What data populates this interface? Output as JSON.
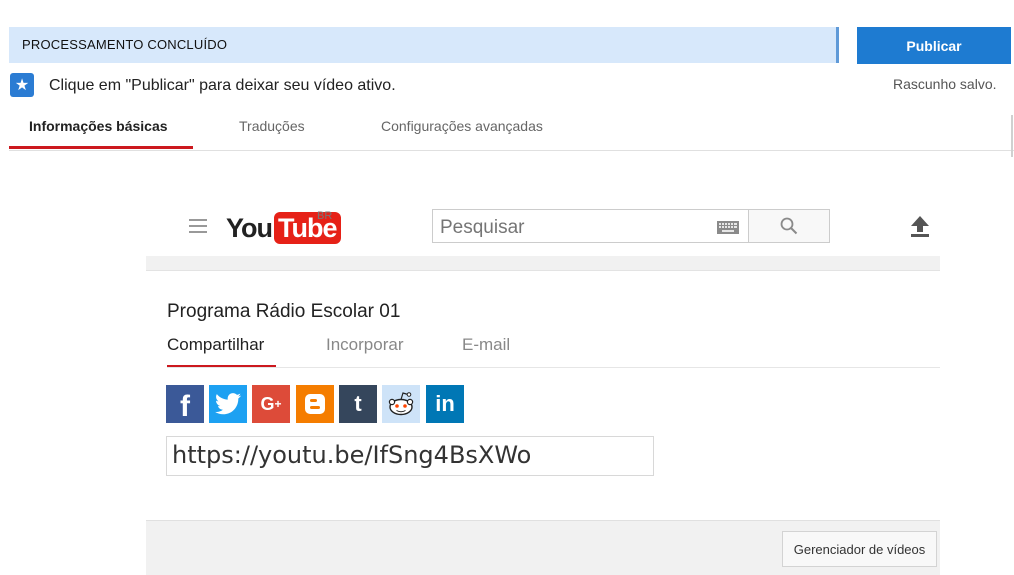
{
  "status": {
    "processing_label": "PROCESSAMENTO CONCLUÍDO",
    "publish_label": "Publicar",
    "info_message": "Clique em \"Publicar\" para deixar seu vídeo ativo.",
    "draft_status": "Rascunho salvo."
  },
  "tabs": [
    {
      "label": "Informações básicas",
      "active": true
    },
    {
      "label": "Traduções",
      "active": false
    },
    {
      "label": "Configurações avançadas",
      "active": false
    }
  ],
  "youtube": {
    "logo_you": "You",
    "logo_tube": "Tube",
    "region": "BR",
    "search_placeholder": "Pesquisar",
    "brand_color": "#e62117"
  },
  "share_panel": {
    "video_title": "Programa Rádio Escolar 01",
    "tabs": [
      {
        "label": "Compartilhar",
        "active": true
      },
      {
        "label": "Incorporar",
        "active": false
      },
      {
        "label": "E-mail",
        "active": false
      }
    ],
    "social": [
      {
        "name": "facebook-icon",
        "glyph": "f",
        "color": "#3b5998"
      },
      {
        "name": "twitter-icon",
        "glyph": "t",
        "color": "#1da1f2"
      },
      {
        "name": "google-plus-icon",
        "glyph": "G+",
        "color": "#dd4b39"
      },
      {
        "name": "blogger-icon",
        "glyph": "B",
        "color": "#f57d00"
      },
      {
        "name": "tumblr-icon",
        "glyph": "t",
        "color": "#35465c"
      },
      {
        "name": "reddit-icon",
        "glyph": "r",
        "color": "#cee3f8"
      },
      {
        "name": "linkedin-icon",
        "glyph": "in",
        "color": "#0077b5"
      }
    ],
    "share_url": "https://youtu.be/IfSng4BsXWo"
  },
  "footer": {
    "manager_label": "Gerenciador de vídeos"
  },
  "colors": {
    "accent": "#1e7bd1",
    "tab_underline": "#cc181e",
    "processing_bg": "#d7e8fb"
  }
}
